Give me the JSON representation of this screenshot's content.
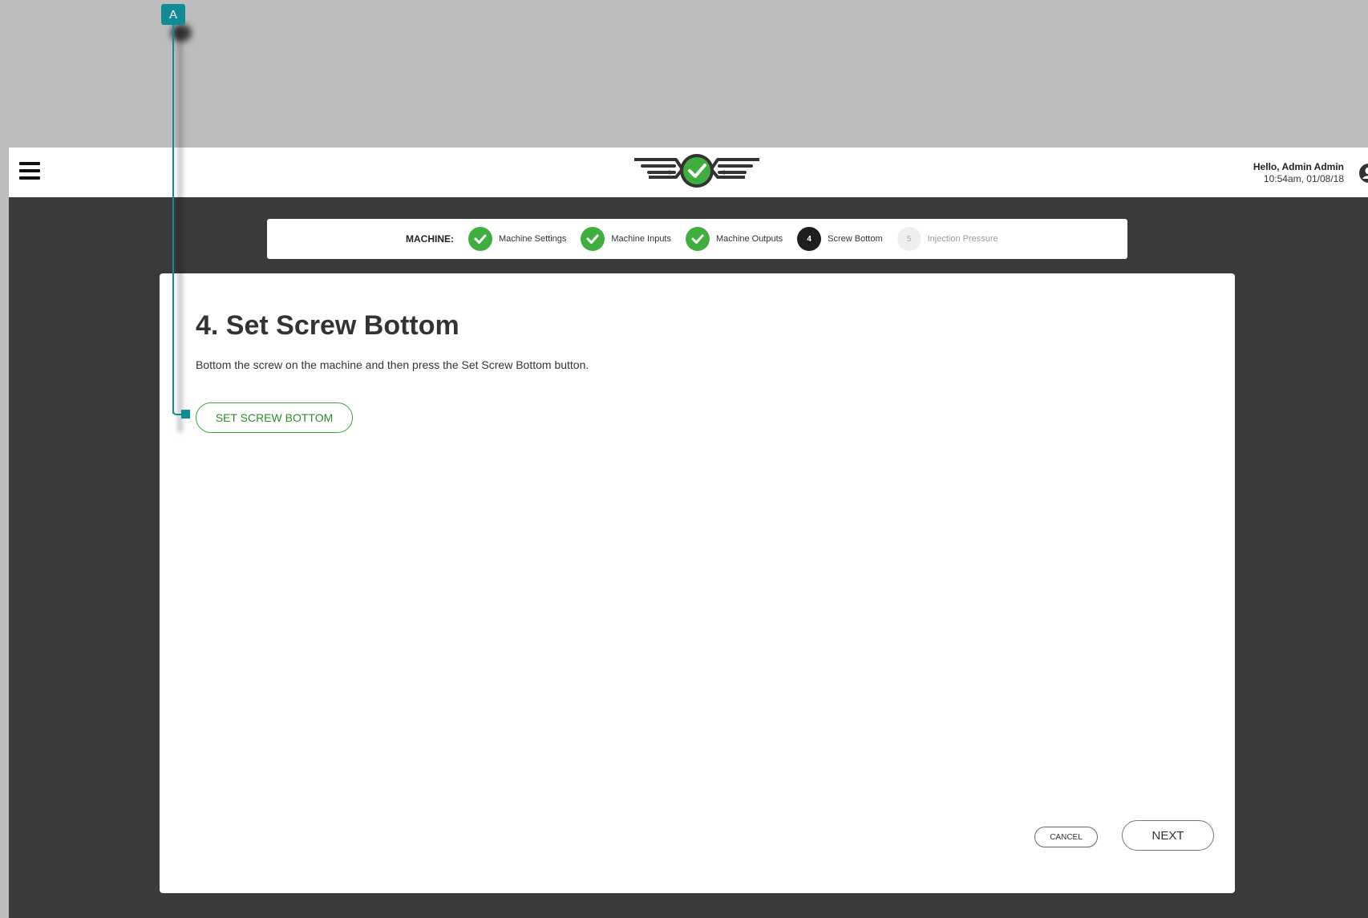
{
  "header": {
    "greeting": "Hello, Admin Admin",
    "timestamp": "10:54am, 01/08/18"
  },
  "stepper": {
    "label": "MACHINE:",
    "steps": [
      {
        "label": "Machine Settings",
        "state": "done",
        "number": ""
      },
      {
        "label": "Machine Inputs",
        "state": "done",
        "number": ""
      },
      {
        "label": "Machine Outputs",
        "state": "done",
        "number": ""
      },
      {
        "label": "Screw Bottom",
        "state": "active",
        "number": "4"
      },
      {
        "label": "Injection Pressure",
        "state": "pending",
        "number": "5"
      }
    ]
  },
  "content": {
    "title": "4. Set Screw Bottom",
    "instructions": "Bottom the screw on the machine and then press the Set Screw Bottom button.",
    "set_button_label": "SET SCREW BOTTOM"
  },
  "footer": {
    "cancel_label": "CANCEL",
    "next_label": "NEXT"
  },
  "callout": {
    "label": "A"
  },
  "colors": {
    "accent_green": "#3fae3f",
    "callout_teal": "#118c96",
    "background_dark": "#3a3a3a"
  },
  "icons": {
    "menu": "hamburger-menu-icon",
    "logo": "winged-check-logo",
    "user": "user-account-icon",
    "step_done": "check-icon"
  }
}
